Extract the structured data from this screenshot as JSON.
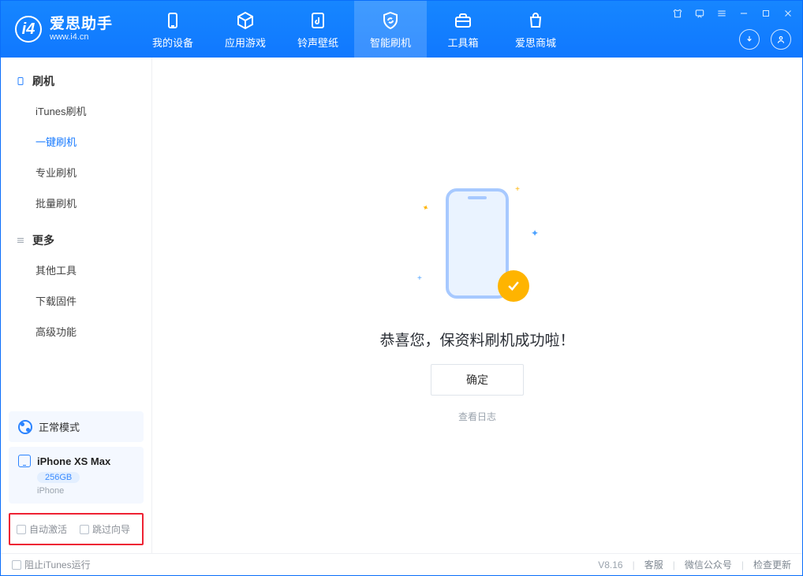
{
  "app": {
    "name_cn": "爱思助手",
    "name_en": "www.i4.cn"
  },
  "nav": {
    "items": [
      {
        "label": "我的设备"
      },
      {
        "label": "应用游戏"
      },
      {
        "label": "铃声壁纸"
      },
      {
        "label": "智能刷机"
      },
      {
        "label": "工具箱"
      },
      {
        "label": "爱思商城"
      }
    ]
  },
  "sidebar": {
    "section_flash": "刷机",
    "items_flash": [
      {
        "label": "iTunes刷机"
      },
      {
        "label": "一键刷机"
      },
      {
        "label": "专业刷机"
      },
      {
        "label": "批量刷机"
      }
    ],
    "section_more": "更多",
    "items_more": [
      {
        "label": "其他工具"
      },
      {
        "label": "下载固件"
      },
      {
        "label": "高级功能"
      }
    ],
    "mode_label": "正常模式",
    "device": {
      "name": "iPhone XS Max",
      "capacity": "256GB",
      "subtype": "iPhone"
    },
    "check_auto_activate": "自动激活",
    "check_skip_guide": "跳过向导"
  },
  "main": {
    "success_text": "恭喜您，保资料刷机成功啦！",
    "ok_button": "确定",
    "view_log": "查看日志"
  },
  "footer": {
    "block_itunes": "阻止iTunes运行",
    "version": "V8.16",
    "link_support": "客服",
    "link_wechat": "微信公众号",
    "link_update": "检查更新"
  }
}
